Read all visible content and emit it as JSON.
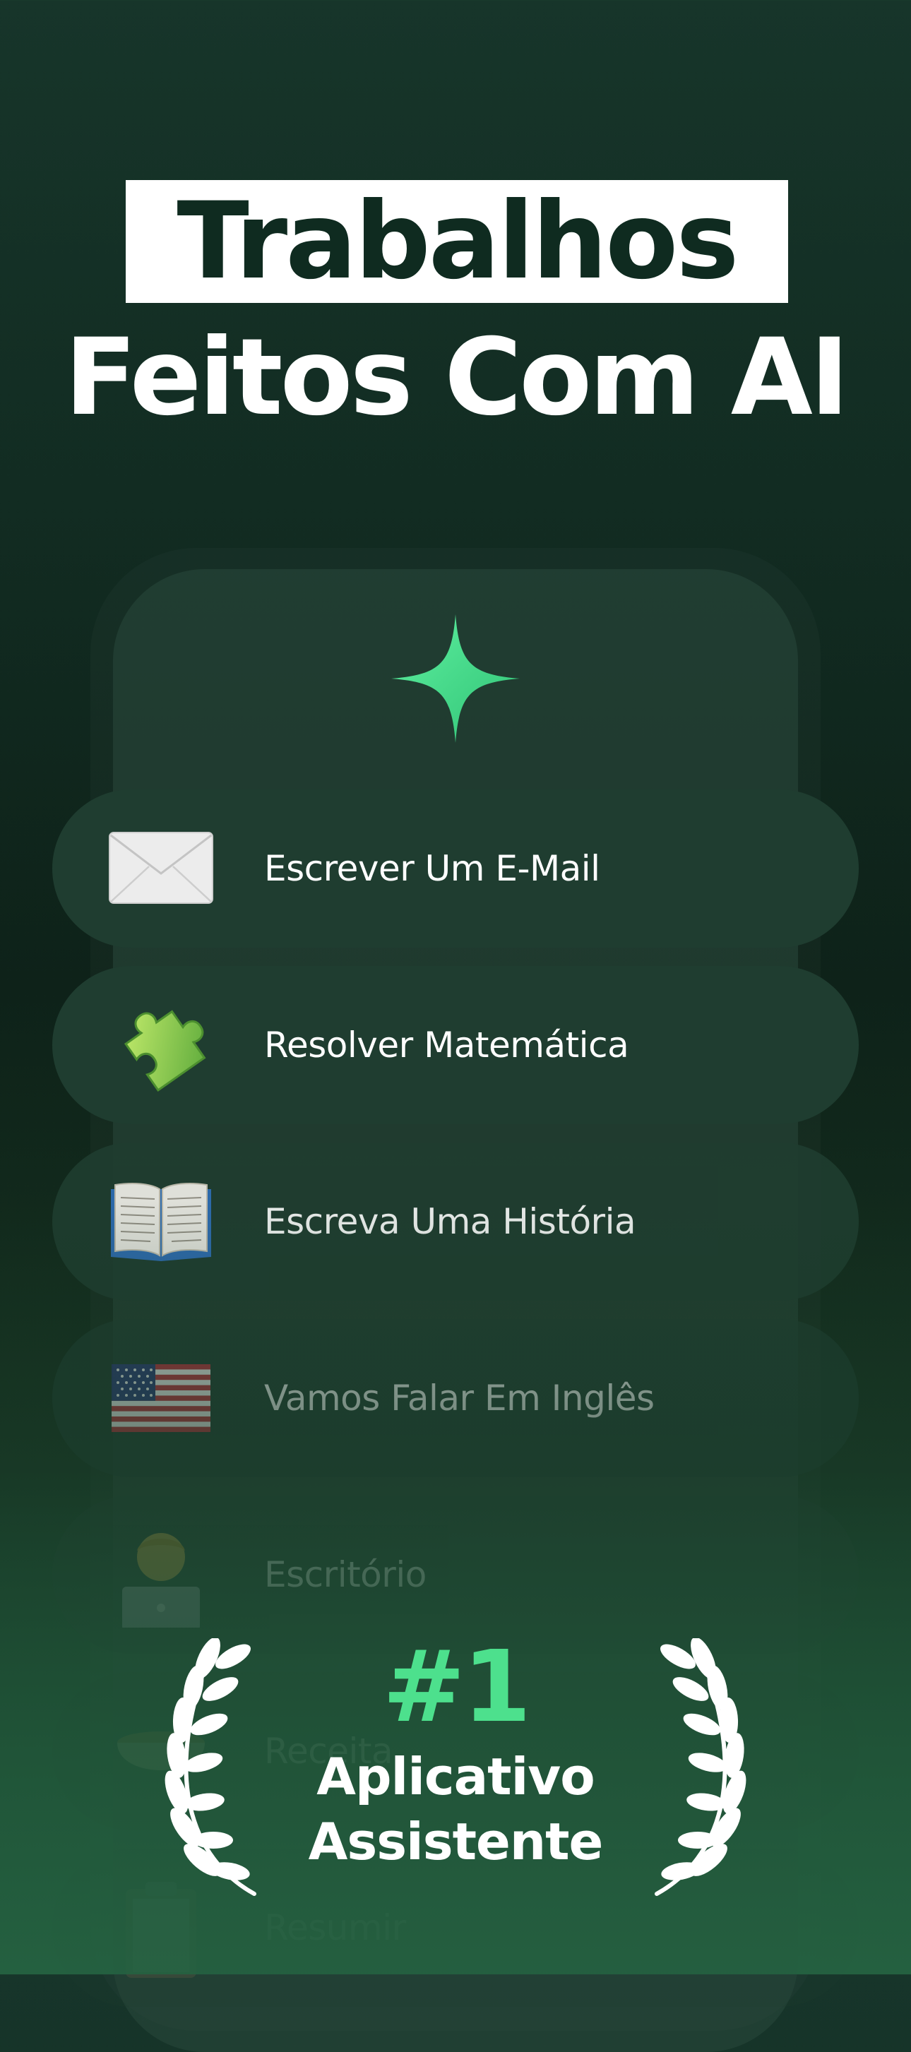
{
  "headline": {
    "line1": "Trabalhos",
    "line2": "Feitos Com AI"
  },
  "icons": {
    "hero": "sparkle-icon",
    "laurel": "laurel-wreath-icon"
  },
  "colors": {
    "accent": "#4de08d",
    "background": "#122c22",
    "pill": "#1f3d30"
  },
  "menu": {
    "items": [
      {
        "label": "Escrever Um E-Mail",
        "icon": "envelope-icon"
      },
      {
        "label": "Resolver Matemática",
        "icon": "puzzle-piece-icon"
      },
      {
        "label": "Escreva Uma História",
        "icon": "open-book-icon"
      },
      {
        "label": "Vamos Falar Em Inglês",
        "icon": "us-flag-icon"
      },
      {
        "label": "Escritório",
        "icon": "office-worker-icon"
      },
      {
        "label": "Receita",
        "icon": "bowl-icon"
      },
      {
        "label": "Resumir",
        "icon": "clipboard-icon"
      }
    ]
  },
  "award": {
    "rank": "#1",
    "line1": "Aplicativo",
    "line2": "Assistente"
  }
}
